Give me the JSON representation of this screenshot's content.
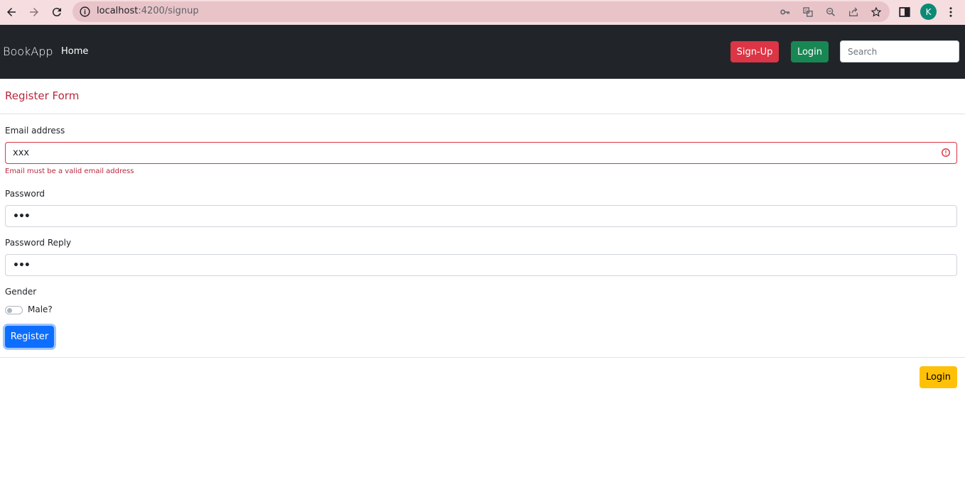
{
  "browser": {
    "url_host": "localhost",
    "url_path": ":4200/signup",
    "profile_initial": "K"
  },
  "navbar": {
    "brand": "BookApp",
    "home_label": "Home",
    "signup_label": "Sign-Up",
    "login_label": "Login",
    "search_placeholder": "Search"
  },
  "form": {
    "title": "Register Form",
    "email": {
      "label": "Email address",
      "value": "xxx",
      "error": "Email must be a valid email address"
    },
    "password": {
      "label": "Password",
      "value": "•••"
    },
    "password_reply": {
      "label": "Password Reply",
      "value": "•••"
    },
    "gender": {
      "label": "Gender",
      "switch_label": "Male?",
      "checked": false
    },
    "register_label": "Register"
  },
  "footer": {
    "login_label": "Login"
  },
  "colors": {
    "navbar_bg": "#212529",
    "danger": "#dc3545",
    "success": "#198754",
    "primary": "#0d6efd",
    "warning": "#ffc107",
    "chrome_bg": "#f5dde0"
  }
}
